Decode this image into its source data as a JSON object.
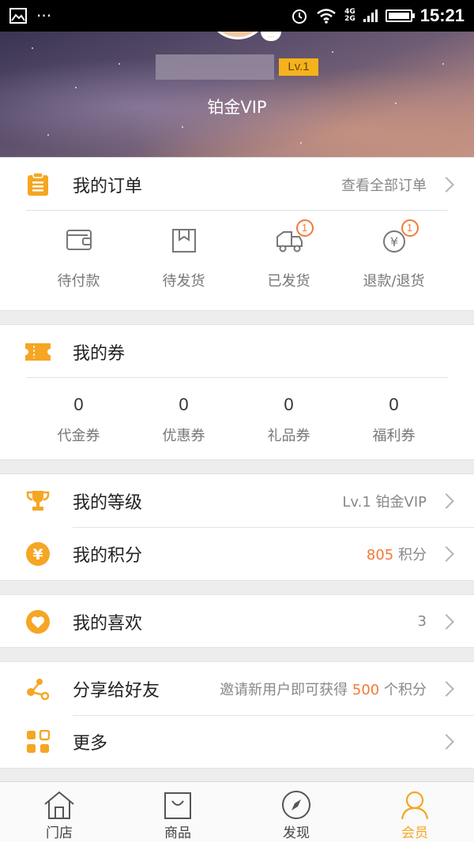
{
  "status_bar": {
    "time": "15:21",
    "network": "4G",
    "network2": "2G"
  },
  "profile": {
    "level_tag": "Lv.1",
    "vip_title": "铂金VIP",
    "avatar_badge": "…"
  },
  "orders": {
    "title": "我的订单",
    "view_all": "查看全部订单",
    "items": [
      {
        "label": "待付款",
        "icon": "wallet-icon",
        "badge": ""
      },
      {
        "label": "待发货",
        "icon": "box-icon",
        "badge": ""
      },
      {
        "label": "已发货",
        "icon": "truck-icon",
        "badge": "1"
      },
      {
        "label": "退款/退货",
        "icon": "refund-yen-icon",
        "badge": "1"
      }
    ]
  },
  "coupons": {
    "title": "我的券",
    "items": [
      {
        "count": "0",
        "label": "代金券"
      },
      {
        "count": "0",
        "label": "优惠券"
      },
      {
        "count": "0",
        "label": "礼品券"
      },
      {
        "count": "0",
        "label": "福利券"
      }
    ]
  },
  "level": {
    "title": "我的等级",
    "value": "Lv.1 铂金VIP"
  },
  "points": {
    "title": "我的积分",
    "value": "805",
    "unit": "积分"
  },
  "favorites": {
    "title": "我的喜欢",
    "value": "3"
  },
  "share": {
    "title": "分享给好友",
    "prefix": "邀请新用户即可获得",
    "points": "500",
    "suffix": "个积分"
  },
  "more": {
    "title": "更多"
  },
  "tabs": [
    {
      "label": "门店",
      "icon": "store-icon",
      "active": false
    },
    {
      "label": "商品",
      "icon": "shopping-bag-icon",
      "active": false
    },
    {
      "label": "发现",
      "icon": "compass-icon",
      "active": false
    },
    {
      "label": "会员",
      "icon": "member-icon",
      "active": true
    }
  ],
  "colors": {
    "accent": "#f5a623",
    "highlight": "#f27a36"
  }
}
